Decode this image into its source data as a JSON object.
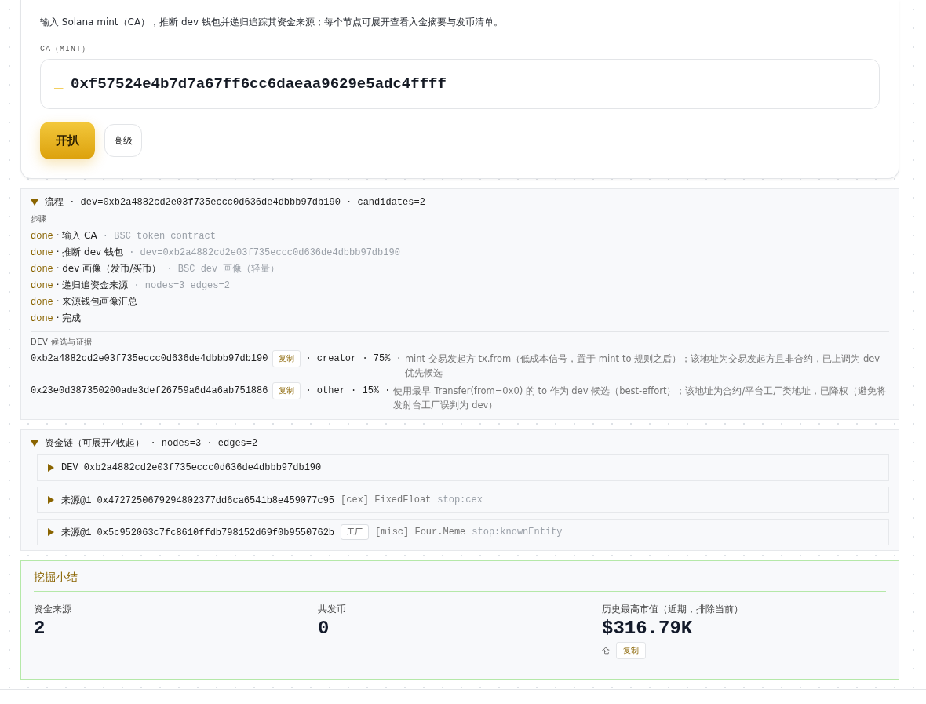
{
  "separator": "·",
  "intro": {
    "description": "输入 Solana mint（CA），推断 dev 钱包并递归追踪其资金来源；每个节点可展开查看入金摘要与发币清单。",
    "field_label": "CA（MINT）",
    "cursor": "_",
    "value": "0xf57524e4b7d7a67ff6cc6daeaa9629e5adc4ffff",
    "buttons": [
      {
        "label": "开扒",
        "kind": "primary"
      },
      {
        "label": "高级",
        "kind": "secondary"
      }
    ]
  },
  "flow": {
    "expanded": true,
    "title": "流程",
    "dev": "dev=0xb2a4882cd2e03f735eccc0d636de4dbbb97db190",
    "candidates": "candidates=2",
    "steps_heading": "步骤",
    "steps": [
      {
        "status": "done",
        "label": "输入 CA",
        "detail": "BSC token contract"
      },
      {
        "status": "done",
        "label": "推断 dev 钱包",
        "detail": "dev=0xb2a4882cd2e03f735eccc0d636de4dbbb97db190"
      },
      {
        "status": "done",
        "label": "dev 画像（发币/买币）",
        "detail": "BSC dev 画像（轻量）"
      },
      {
        "status": "done",
        "label": "递归追资金来源",
        "detail": "nodes=3 edges=2"
      },
      {
        "status": "done",
        "label": "来源钱包画像汇总"
      },
      {
        "status": "done",
        "label": "完成"
      }
    ],
    "candidates_heading": "DEV 候选与证据",
    "candidate_list": [
      {
        "address": "0xb2a4882cd2e03f735eccc0d636de4dbbb97db190",
        "copy": "复制",
        "role": "creator",
        "percent": "75%",
        "reason": "mint 交易发起方 tx.from（低成本信号，置于 mint-to 规则之后）；该地址为交易发起方且非合约，已上调为 dev 优先候选"
      },
      {
        "address": "0x23e0d387350200ade3def26759a6d4a6ab751886",
        "copy": "复制",
        "role": "other",
        "percent": "15%",
        "reason": "使用最早 Transfer(from=0x0) 的 to 作为 dev 候选（best-effort）；该地址为合约/平台工厂类地址，已降权（避免将发射台工厂误判为 dev）"
      }
    ]
  },
  "chain": {
    "expanded": true,
    "title": "资金链（可展开/收起）",
    "nodes": "nodes=3",
    "edges": "edges=2",
    "items": [
      {
        "expanded": false,
        "label": "DEV",
        "address": "0xb2a4882cd2e03f735eccc0d636de4dbbb97db190"
      },
      {
        "expanded": false,
        "label": "来源@1",
        "address": "0x4727250679294802377dd6ca6541b8e459077c95",
        "category": "[cex]",
        "name": "FixedFloat",
        "stop": "stop:cex"
      },
      {
        "expanded": false,
        "label": "来源@1",
        "address": "0x5c952063c7fc8610ffdb798152d69f0b9550762b",
        "tag": "工厂",
        "category": "[misc]",
        "name": "Four.Meme",
        "stop": "stop:knownEntity"
      }
    ]
  },
  "summary": {
    "title": "挖掘小结",
    "stats": [
      {
        "label": "资金来源",
        "value": "2"
      },
      {
        "label": "共发币",
        "value": "0"
      },
      {
        "label": "历史最高市值（近期，排除当前）",
        "value": "$316.79K",
        "note": "仑",
        "copy": "复制"
      }
    ]
  }
}
